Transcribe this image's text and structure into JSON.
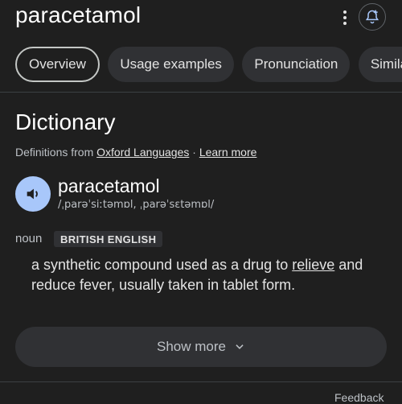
{
  "header": {
    "query": "paracetamol",
    "more_icon": "more-vert-icon",
    "alert_icon": "bell-plus-icon"
  },
  "tabs": [
    {
      "label": "Overview",
      "active": true
    },
    {
      "label": "Usage examples",
      "active": false
    },
    {
      "label": "Pronunciation",
      "active": false
    },
    {
      "label": "Similar",
      "active": false
    }
  ],
  "dictionary": {
    "title": "Dictionary",
    "source_prefix": "Definitions from",
    "source_name": "Oxford Languages",
    "separator": "·",
    "learn_more": "Learn more",
    "headword": "paracetamol",
    "phonetic": "/ˌparəˈsiːtəmɒl, ˌparəˈsɛtəmɒl/",
    "part_of_speech": "noun",
    "region_badge": "BRITISH ENGLISH",
    "definition_before": "a synthetic compound used as a drug to ",
    "definition_link": "relieve",
    "definition_after": " and reduce fever, usually taken in tablet form.",
    "show_more": "Show more"
  },
  "footer": {
    "feedback": "Feedback"
  },
  "colors": {
    "background": "#1f1f1f",
    "chip_bg": "#303134",
    "speaker_bg": "#a8c7fa"
  }
}
